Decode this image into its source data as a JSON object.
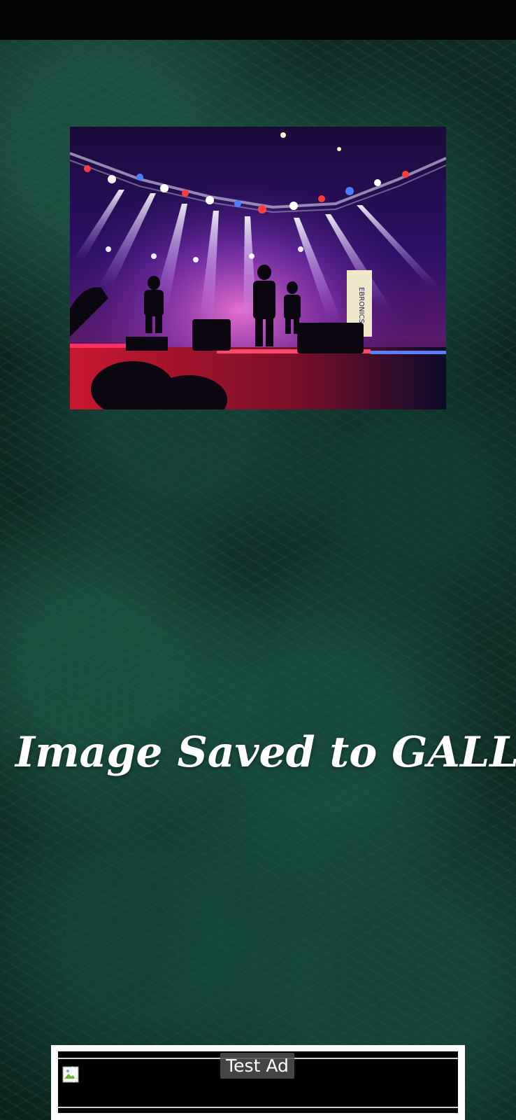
{
  "screen": {
    "background_description_icon": "evergreen-foliage-background",
    "background_color": "#0f2a24"
  },
  "photo": {
    "icon": "concert-stage-photo",
    "stage_banner_text": "EBRONICS"
  },
  "caption": {
    "text": "Image Saved to GALLERY"
  },
  "ad": {
    "label": "Test Ad",
    "broken_image_icon": "broken-image-icon"
  }
}
